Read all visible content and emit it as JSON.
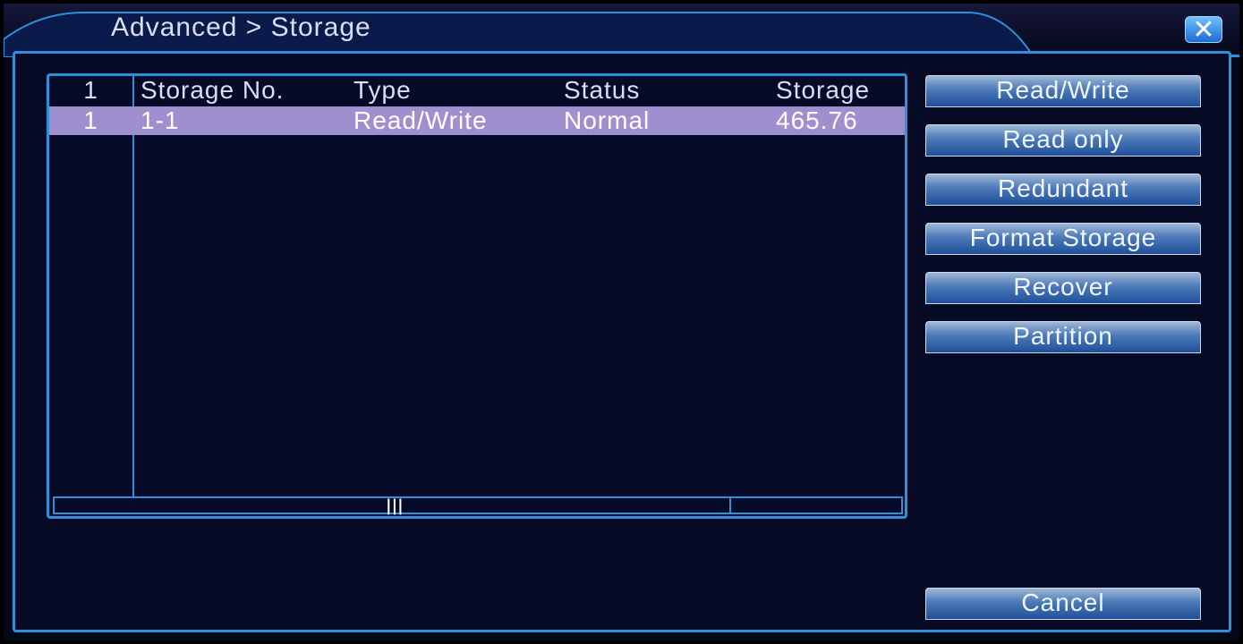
{
  "title": "Advanced > Storage",
  "table": {
    "headers": {
      "index": "1",
      "storage_no": "Storage No.",
      "type": "Type",
      "status": "Status",
      "storage": "Storage"
    },
    "rows": [
      {
        "index": "1",
        "storage_no": "1-1",
        "type": "Read/Write",
        "status": "Normal",
        "storage": "465.76"
      }
    ]
  },
  "buttons": {
    "read_write": "Read/Write",
    "read_only": "Read only",
    "redundant": "Redundant",
    "format_storage": "Format Storage",
    "recover": "Recover",
    "partition": "Partition",
    "cancel": "Cancel"
  },
  "icons": {
    "close": "close-icon",
    "scroll_grip": "grip-icon"
  },
  "colors": {
    "accent": "#2f8fd8",
    "selected_row": "#9f8fcf",
    "background": "#05081a"
  }
}
